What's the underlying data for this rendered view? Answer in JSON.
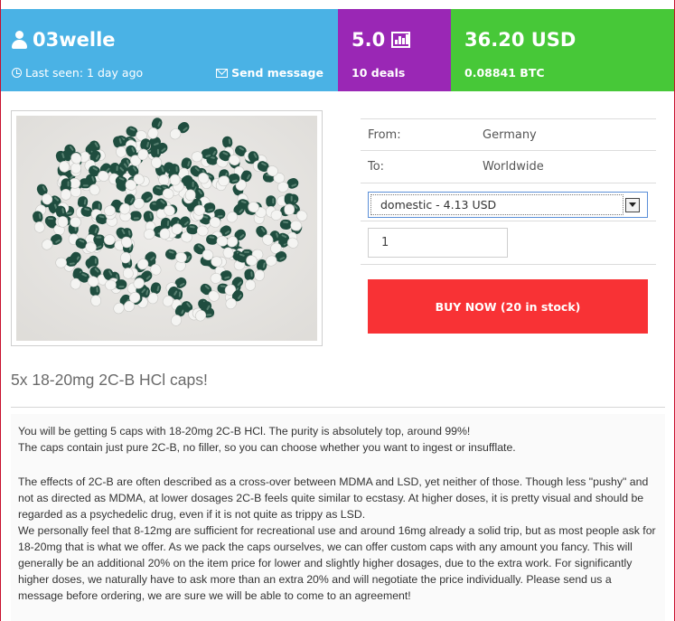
{
  "vendor": {
    "name": "03welle",
    "last_seen": "Last seen: 1 day ago",
    "send_message": "Send message"
  },
  "rating": {
    "value": "5.0",
    "deals": "10 deals"
  },
  "price": {
    "usd": "36.20 USD",
    "btc": "0.08841 BTC"
  },
  "info": {
    "from_label": "From:",
    "from_value": "Germany",
    "to_label": "To:",
    "to_value": "Worldwide",
    "shipping_selected": "domestic - 4.13 USD",
    "quantity": "1"
  },
  "buy_button": "BUY NOW (20 in stock)",
  "product_title": "5x 18-20mg 2C-B HCl caps!",
  "description": {
    "p1": "You will be getting 5 caps with 18-20mg 2C-B HCl. The purity is absolutely top, around 99%!",
    "p2": "The caps contain just pure 2C-B, no filler, so you can choose whether you want to ingest or insufflate.",
    "p3": "The effects of 2C-B are often described as a cross-over between MDMA and LSD, yet neither of those. Though less \"pushy\" and not as directed as MDMA, at lower dosages 2C-B feels quite similar to ecstasy. At higher doses, it is pretty visual and should be regarded as a psychedelic drug, even if it is not quite as trippy as LSD.",
    "p4": "We personally feel that 8-12mg are sufficient for recreational use and around 16mg already a solid trip, but as most people ask for 18-20mg that is what we offer. As we pack the caps ourselves, we can offer custom caps with any amount you fancy. This will generally be an additional 20% on the item price for lower and slightly higher dosages, due to the extra work. For significantly higher doses, we naturally have to ask more than an extra 20% and will negotiate the price individually. Please send us a message before ordering, we are sure we will be able to come to an agreement!"
  },
  "colors": {
    "vendor_bg": "#4ab2e5",
    "rating_bg": "#9a27b5",
    "price_bg": "#47c838",
    "buy_bg": "#f83235",
    "capsule_green": "#1f4d3f",
    "capsule_white": "#f4f4f2"
  },
  "icons": [
    "user-icon",
    "clock-icon",
    "mail-icon",
    "bar-chart-icon",
    "chevron-down-icon"
  ]
}
